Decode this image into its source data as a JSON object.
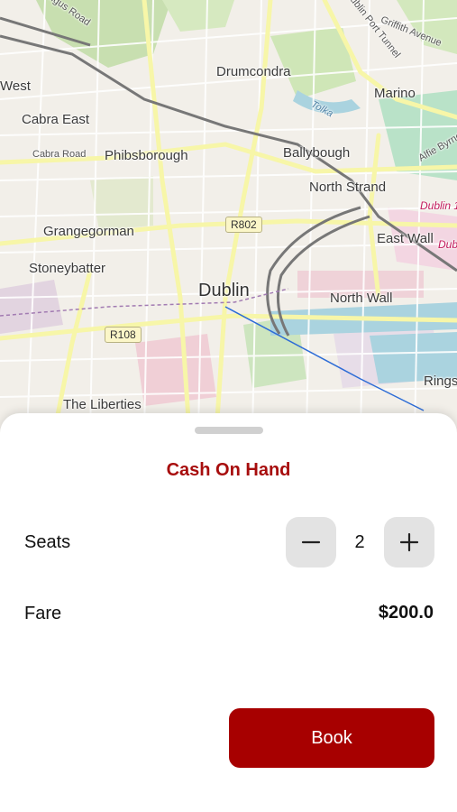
{
  "map": {
    "labels": {
      "drumcondra": "Drumcondra",
      "marino": "Marino",
      "cabra_east": "Cabra East",
      "cabra_road": "Cabra Road",
      "phibsborough": "Phibsborough",
      "ballybough": "Ballybough",
      "north_strand": "North Strand",
      "grangegorman": "Grangegorman",
      "east_wall": "East Wall",
      "stoneybatter": "Stoneybatter",
      "dublin": "Dublin",
      "north_wall": "North Wall",
      "the_liberties": "The Liberties",
      "rings": "Rings",
      "west": "West",
      "griffith_avenue": "Griffith Avenue",
      "dublin_port_tunnel": "Dublin Port Tunnel",
      "tolka": "Tolka",
      "alfie_byrne": "Alfie Byrne",
      "dublin_1": "Dublin 1",
      "dub": "Dub",
      "glasnevin_road": "ngus Road"
    },
    "shields": {
      "r802": "R802",
      "r108": "R108"
    }
  },
  "sheet": {
    "title": "Cash On Hand",
    "seats_label": "Seats",
    "seats_value": "2",
    "fare_label": "Fare",
    "fare_value": "$200.0",
    "book_label": "Book",
    "accent_color": "#a70000"
  }
}
